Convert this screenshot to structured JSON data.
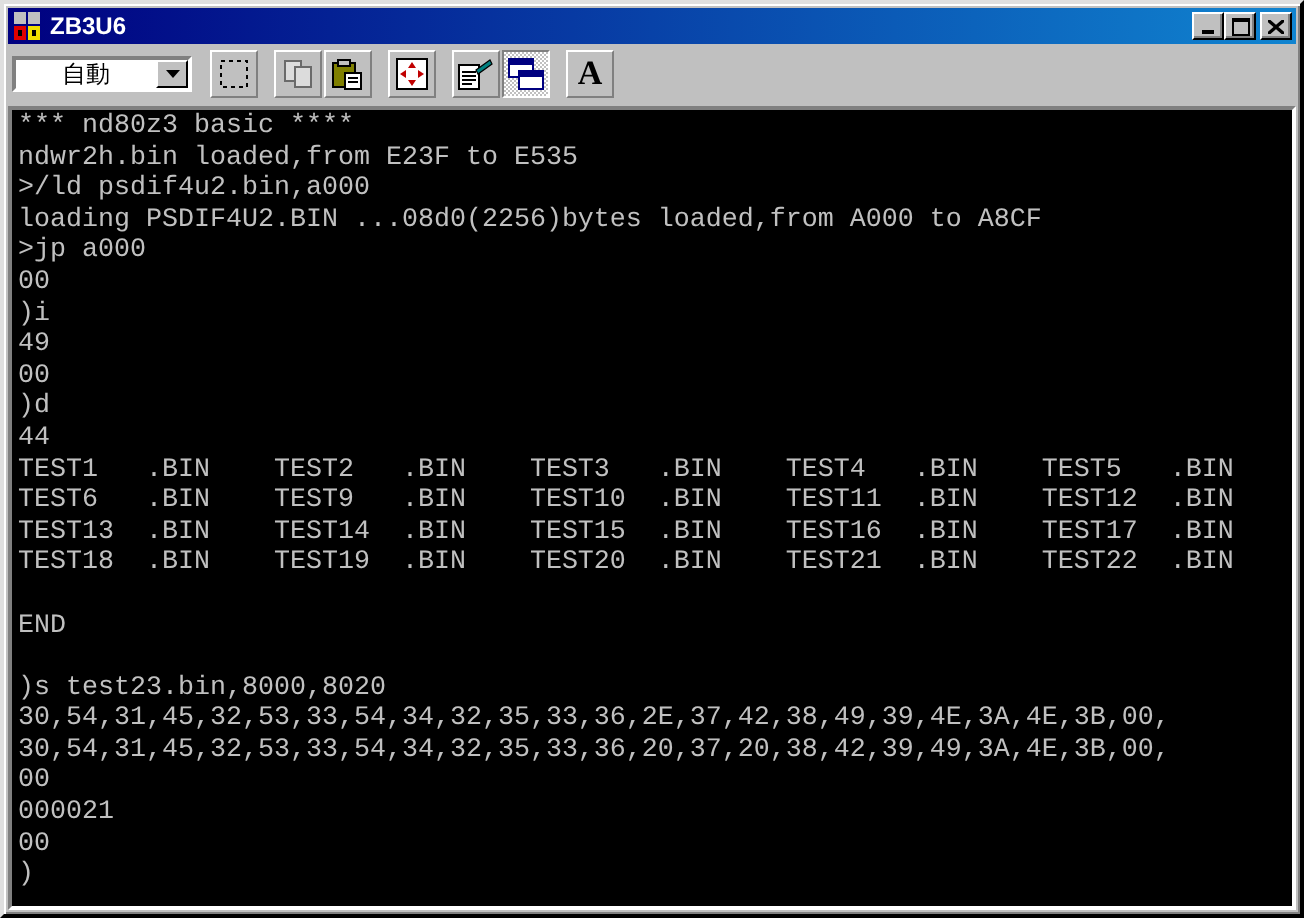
{
  "window": {
    "title": "ZB3U6"
  },
  "toolbar": {
    "font_size": "自動",
    "tools": [
      {
        "kind": "mark",
        "disabled": false,
        "pressed": false
      },
      {
        "kind": "copy",
        "disabled": true,
        "pressed": false
      },
      {
        "kind": "paste",
        "disabled": false,
        "pressed": false
      },
      {
        "kind": "fullscreen",
        "disabled": false,
        "pressed": false
      },
      {
        "kind": "properties",
        "disabled": false,
        "pressed": false
      },
      {
        "kind": "background",
        "disabled": false,
        "pressed": true
      },
      {
        "kind": "font",
        "label": "A",
        "disabled": false,
        "pressed": false
      }
    ]
  },
  "console": {
    "blocks": [
      {
        "lines": [
          "*** nd80z3 basic ****",
          "ndwr2h.bin loaded,from E23F to E535",
          ">/ld psdif4u2.bin,a000",
          "loading PSDIF4U2.BIN ...08d0(2256)bytes loaded,from A000 to A8CF",
          ">jp a000",
          "00",
          ")i",
          "49",
          "00",
          ")d",
          "44",
          "TEST1   .BIN    TEST2   .BIN    TEST3   .BIN    TEST4   .BIN    TEST5   .BIN",
          "TEST6   .BIN    TEST9   .BIN    TEST10  .BIN    TEST11  .BIN    TEST12  .BIN",
          "TEST13  .BIN    TEST14  .BIN    TEST15  .BIN    TEST16  .BIN    TEST17  .BIN",
          "TEST18  .BIN    TEST19  .BIN    TEST20  .BIN    TEST21  .BIN    TEST22  .BIN"
        ]
      },
      {
        "lines": [
          "END"
        ]
      },
      {
        "lines": [
          ")s test23.bin,8000,8020",
          "30,54,31,45,32,53,33,54,34,32,35,33,36,2E,37,42,38,49,39,4E,3A,4E,3B,00,",
          "30,54,31,45,32,53,33,54,34,32,35,33,36,20,37,20,38,42,39,49,3A,4E,3B,00,",
          "00",
          "000021",
          "00",
          ")"
        ]
      }
    ]
  }
}
